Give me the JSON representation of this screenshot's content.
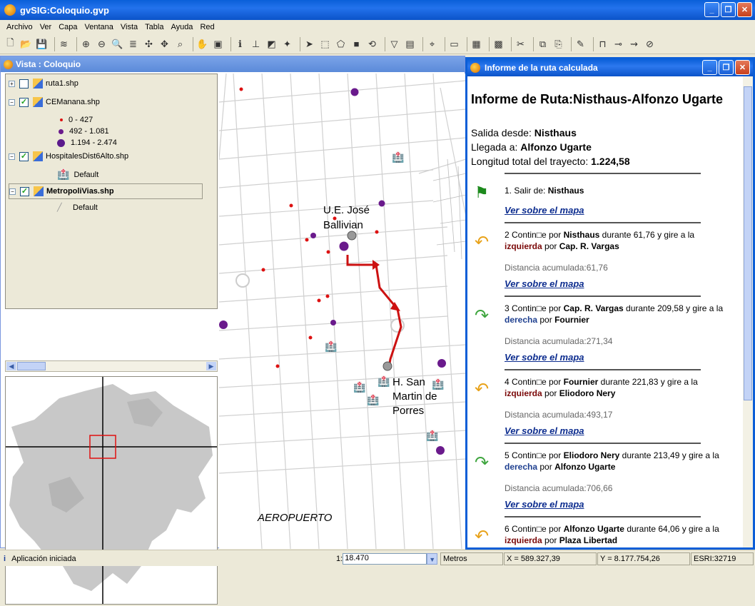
{
  "window": {
    "title": "gvSIG:Coloquio.gvp"
  },
  "menu": [
    "Archivo",
    "Ver",
    "Capa",
    "Ventana",
    "Vista",
    "Tabla",
    "Ayuda",
    "Red"
  ],
  "view": {
    "title": "Vista : Coloquio",
    "layers": [
      {
        "name": "ruta1.shp",
        "checked": false
      },
      {
        "name": "CEManana.shp",
        "checked": true
      },
      {
        "name": "HospitalesDist6Alto.shp",
        "checked": true
      },
      {
        "name": "MetropoliVias.shp",
        "checked": true
      }
    ],
    "legend_cemanana": [
      "0 - 427",
      "492 - 1.081",
      "1.194 - 2.474"
    ],
    "legend_default": "Default",
    "legend_default2": "Default",
    "map_labels": {
      "origin": "U.E. José\nBallivian",
      "dest": "H. San\nMartin de\nPorres",
      "airport": "AEROPUERTO"
    }
  },
  "report": {
    "window_title": "Informe de la ruta calculada",
    "heading": "Informe de Ruta:Nisthaus-Alfonzo Ugarte",
    "salida_label": "Salida desde:",
    "salida": "Nisthaus",
    "llegada_label": "Llegada a:",
    "llegada": "Alfonzo Ugarte",
    "longitud_label": "Longitud total del trayecto:",
    "longitud": "1.224,58",
    "link": "Ver sobre el mapa",
    "step1": {
      "pre": "1. Salir de:",
      "name": "Nisthaus"
    },
    "steps": [
      {
        "n": "2 Contin□e por",
        "street": "Nisthaus",
        "dist": "durante 61,76 y gire a la",
        "dir": "izquierda",
        "por": "por",
        "next": "Cap. R. Vargas",
        "acum": "Distancia acumulada:61,76",
        "kind": "left"
      },
      {
        "n": "3 Contin□e por",
        "street": "Cap. R. Vargas",
        "dist": "durante 209,58 y gire a la",
        "dir": "derecha",
        "por": "por",
        "next": "Fournier",
        "acum": "Distancia acumulada:271,34",
        "kind": "right"
      },
      {
        "n": "4 Contin□e por",
        "street": "Fournier",
        "dist": "durante 221,83 y gire a la",
        "dir": "izquierda",
        "por": "por",
        "next": "Eliodoro Nery",
        "acum": "Distancia acumulada:493,17",
        "kind": "left"
      },
      {
        "n": "5 Contin□e por",
        "street": "Eliodoro Nery",
        "dist": "durante 213,49 y gire a la",
        "dir": "derecha",
        "por": "por",
        "next": "Alfonzo Ugarte",
        "acum": "Distancia acumulada:706,66",
        "kind": "right"
      },
      {
        "n": "6 Contin□e por",
        "street": "Alfonzo Ugarte",
        "dist": "durante 64,06 y gire a la",
        "dir": "izquierda",
        "por": "por",
        "next": "Plaza Libertad",
        "acum": "",
        "kind": "left"
      }
    ]
  },
  "status": {
    "message": "Aplicación iniciada",
    "scale_prefix": "1:",
    "scale": "18.470",
    "units": "Metros",
    "x": "X = 589.327,39",
    "y": "Y = 8.177.754,26",
    "crs": "ESRI:32719"
  },
  "colors": {
    "route": "#cc1111",
    "titlebar": "#0b5ed7",
    "link": "#0d2d8f"
  }
}
